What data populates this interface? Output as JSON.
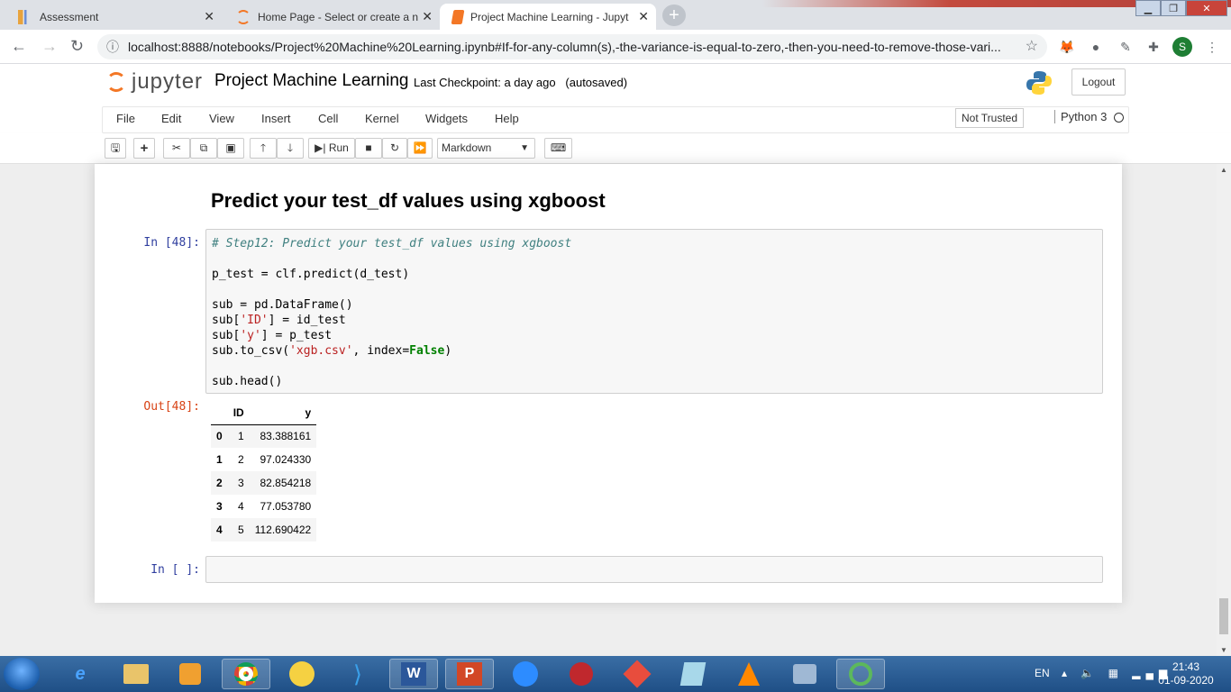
{
  "browser": {
    "tabs": [
      {
        "label": "Assessment"
      },
      {
        "label": "Home Page - Select or create a n"
      },
      {
        "label": "Project Machine Learning - Jupyt"
      }
    ],
    "url": "localhost:8888/notebooks/Project%20Machine%20Learning.ipynb#If-for-any-column(s),-the-variance-is-equal-to-zero,-then-you-need-to-remove-those-vari...",
    "profile_initial": "S"
  },
  "jupyter": {
    "logo_text": "jupyter",
    "notebook_title": "Project Machine Learning",
    "checkpoint_text": "Last Checkpoint: a day ago",
    "autosave_text": "(autosaved)",
    "logout_label": "Logout",
    "menu": [
      "File",
      "Edit",
      "View",
      "Insert",
      "Cell",
      "Kernel",
      "Widgets",
      "Help"
    ],
    "trust_label": "Not Trusted",
    "kernel_name": "Python 3",
    "toolbar": {
      "run_label": "Run",
      "cell_type": "Markdown"
    }
  },
  "notebook": {
    "markdown_heading": "Predict your test_df values using xgboost",
    "code_cell": {
      "prompt": "In [48]:",
      "comment": "# Step12: Predict your test_df values using xgboost",
      "line2": "p_test = clf.predict(d_test)",
      "line3": "sub = pd.DataFrame()",
      "line4a": "sub[",
      "line4s": "'ID'",
      "line4b": "] = id_test",
      "line5a": "sub[",
      "line5s": "'y'",
      "line5b": "] = p_test",
      "line6a": "sub.to_csv(",
      "line6s": "'xgb.csv'",
      "line6b": ", index=",
      "line6k": "False",
      "line6c": ")",
      "line7": "sub.head()"
    },
    "output": {
      "prompt": "Out[48]:",
      "columns": [
        "ID",
        "y"
      ],
      "rows": [
        {
          "index": "0",
          "ID": "1",
          "y": "83.388161"
        },
        {
          "index": "1",
          "ID": "2",
          "y": "97.024330"
        },
        {
          "index": "2",
          "ID": "3",
          "y": "82.854218"
        },
        {
          "index": "3",
          "ID": "4",
          "y": "77.053780"
        },
        {
          "index": "4",
          "ID": "5",
          "y": "112.690422"
        }
      ]
    },
    "empty_cell_prompt": "In [ ]:"
  },
  "taskbar": {
    "language": "EN",
    "time": "21:43",
    "date": "01-09-2020"
  }
}
